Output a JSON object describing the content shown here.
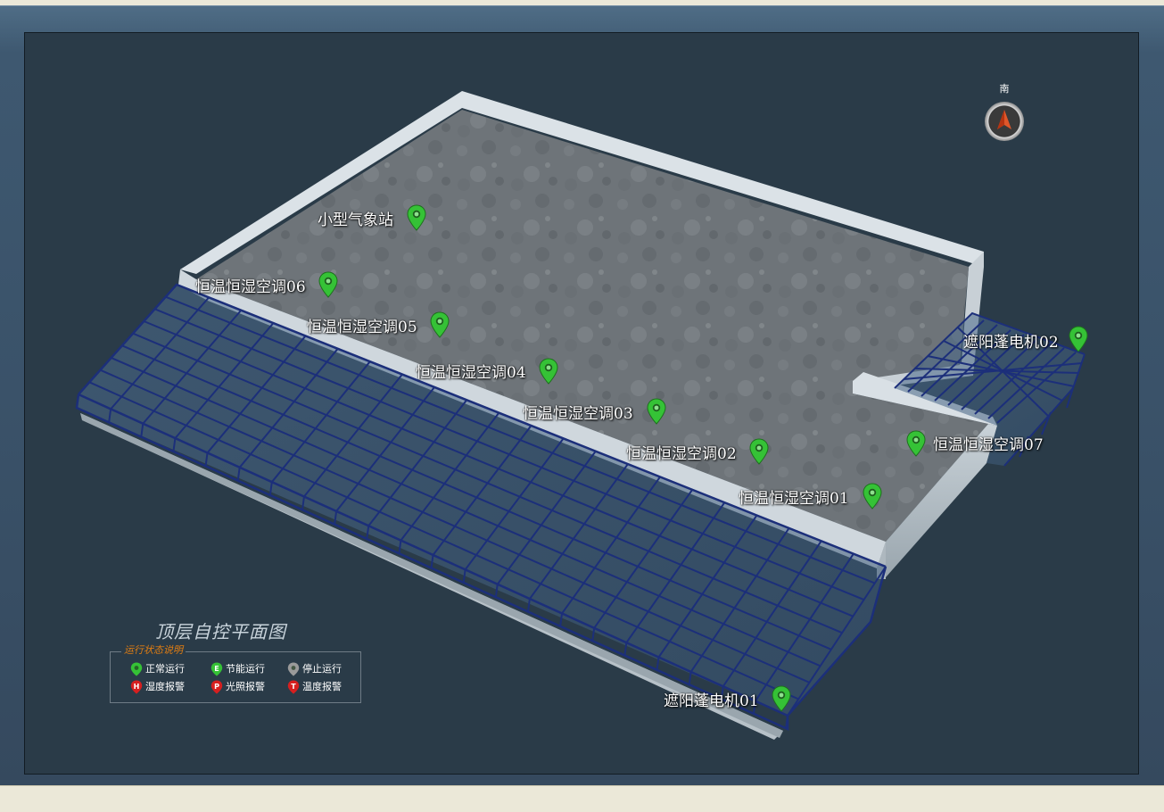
{
  "compass": {
    "label": "南"
  },
  "plan": {
    "title": "顶层自控平面图"
  },
  "legend": {
    "title": "运行状态说明",
    "items": [
      {
        "label": "正常运行",
        "icon": "green-pin-icon",
        "color": "#35c236",
        "glyph": ""
      },
      {
        "label": "节能运行",
        "icon": "energy-saving-e-icon",
        "color": "#35c236",
        "glyph": "E"
      },
      {
        "label": "停止运行",
        "icon": "gray-pin-icon",
        "color": "#9a9a9a",
        "glyph": ""
      },
      {
        "label": "湿度报警",
        "icon": "humidity-alarm-h-icon",
        "color": "#d61f1f",
        "glyph": "H"
      },
      {
        "label": "光照报警",
        "icon": "light-alarm-p-icon",
        "color": "#d61f1f",
        "glyph": "P"
      },
      {
        "label": "温度报警",
        "icon": "temperature-alarm-t-icon",
        "color": "#d61f1f",
        "glyph": "T"
      }
    ]
  },
  "devices": [
    {
      "id": "weather",
      "label": "小型气象站",
      "status": "正常运行"
    },
    {
      "id": "ac06",
      "label": "恒温恒湿空调06",
      "status": "正常运行"
    },
    {
      "id": "ac05",
      "label": "恒温恒湿空调05",
      "status": "正常运行"
    },
    {
      "id": "ac04",
      "label": "恒温恒湿空调04",
      "status": "正常运行"
    },
    {
      "id": "ac03",
      "label": "恒温恒湿空调03",
      "status": "正常运行"
    },
    {
      "id": "ac02",
      "label": "恒温恒湿空调02",
      "status": "正常运行"
    },
    {
      "id": "ac01",
      "label": "恒温恒湿空调01",
      "status": "正常运行"
    },
    {
      "id": "ac07",
      "label": "恒温恒湿空调07",
      "status": "正常运行"
    },
    {
      "id": "shade02",
      "label": "遮阳蓬电机02",
      "status": "正常运行"
    },
    {
      "id": "shade01",
      "label": "遮阳蓬电机01",
      "status": "正常运行"
    }
  ],
  "colors": {
    "normal": "#35c236",
    "stopped": "#9a9a9a",
    "alarm": "#d61f1f",
    "legend_title": "#e07d12",
    "stage_bg": "#2a3b48",
    "greenhouse_frame": "#1c2f7a"
  }
}
